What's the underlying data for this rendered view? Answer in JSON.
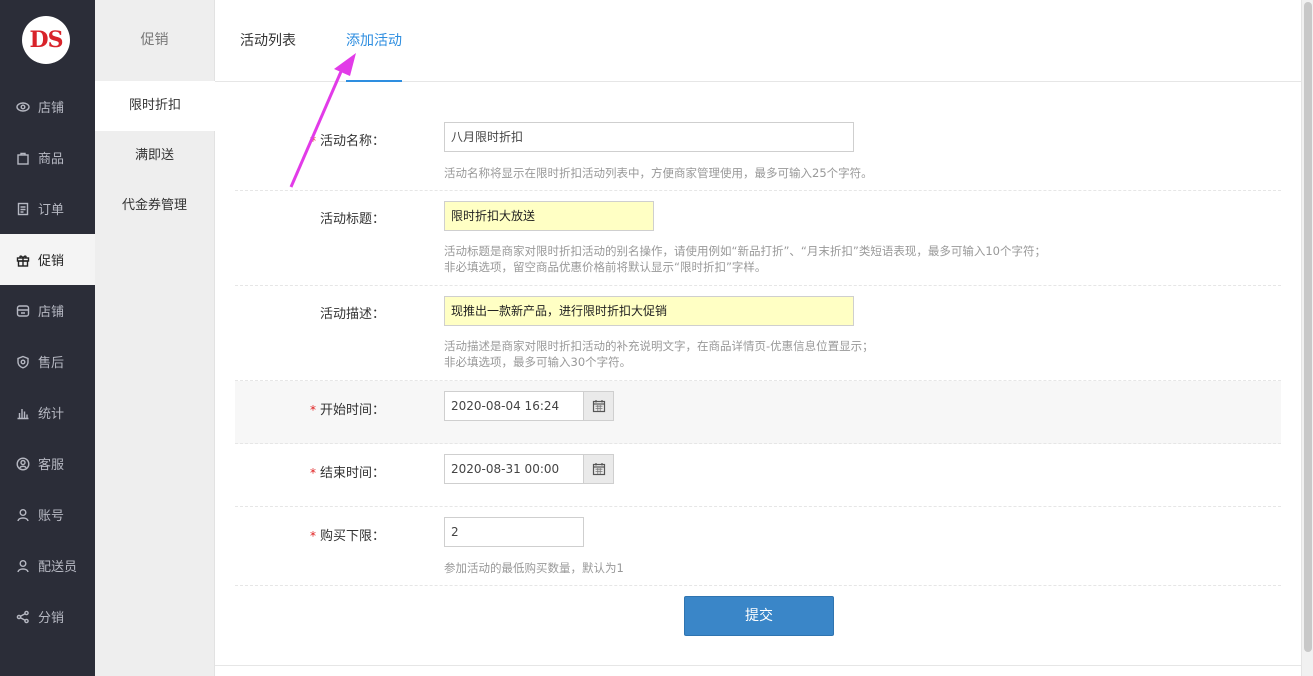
{
  "logo": {
    "text": "DS"
  },
  "nav": {
    "items": [
      {
        "label": "店铺",
        "icon": "eye-icon"
      },
      {
        "label": "商品",
        "icon": "bag-icon"
      },
      {
        "label": "订单",
        "icon": "order-icon"
      },
      {
        "label": "促销",
        "icon": "gift-icon",
        "active": true
      },
      {
        "label": "店铺",
        "icon": "store-icon"
      },
      {
        "label": "售后",
        "icon": "shield-icon"
      },
      {
        "label": "统计",
        "icon": "bar-chart-icon"
      },
      {
        "label": "客服",
        "icon": "customer-service-icon"
      },
      {
        "label": "账号",
        "icon": "user-icon"
      },
      {
        "label": "配送员",
        "icon": "courier-icon"
      },
      {
        "label": "分销",
        "icon": "share-icon"
      }
    ]
  },
  "subnav": {
    "title": "促销",
    "items": [
      {
        "label": "限时折扣",
        "active": true
      },
      {
        "label": "满即送"
      },
      {
        "label": "代金券管理"
      }
    ]
  },
  "tabs": [
    {
      "label": "活动列表"
    },
    {
      "label": "添加活动",
      "active": true
    }
  ],
  "form": {
    "required_mark": "*",
    "name": {
      "label": "活动名称：",
      "value": "八月限时折扣",
      "hint": "活动名称将显示在限时折扣活动列表中，方便商家管理使用，最多可输入25个字符。"
    },
    "title": {
      "label": "活动标题：",
      "value": "限时折扣大放送",
      "hint1": "活动标题是商家对限时折扣活动的别名操作，请使用例如“新品打折”、“月末折扣”类短语表现，最多可输入10个字符；",
      "hint2": "非必填选项，留空商品优惠价格前将默认显示“限时折扣”字样。"
    },
    "desc": {
      "label": "活动描述：",
      "value": "现推出一款新产品，进行限时折扣大促销",
      "hint1": "活动描述是商家对限时折扣活动的补充说明文字，在商品详情页-优惠信息位置显示；",
      "hint2": "非必填选项，最多可输入30个字符。"
    },
    "start": {
      "label": "开始时间：",
      "value": "2020-08-04 16:24"
    },
    "end": {
      "label": "结束时间：",
      "value": "2020-08-31 00:00"
    },
    "min_buy": {
      "label": "购买下限：",
      "value": "2",
      "hint": "参加活动的最低购买数量，默认为1"
    },
    "submit_label": "提交"
  },
  "colors": {
    "accent": "#2e8ee0",
    "nav_bg": "#2b2d38",
    "submit_bg": "#3a86c8",
    "highlight_input": "#ffffc4",
    "annotation_arrow": "#e23be8"
  }
}
